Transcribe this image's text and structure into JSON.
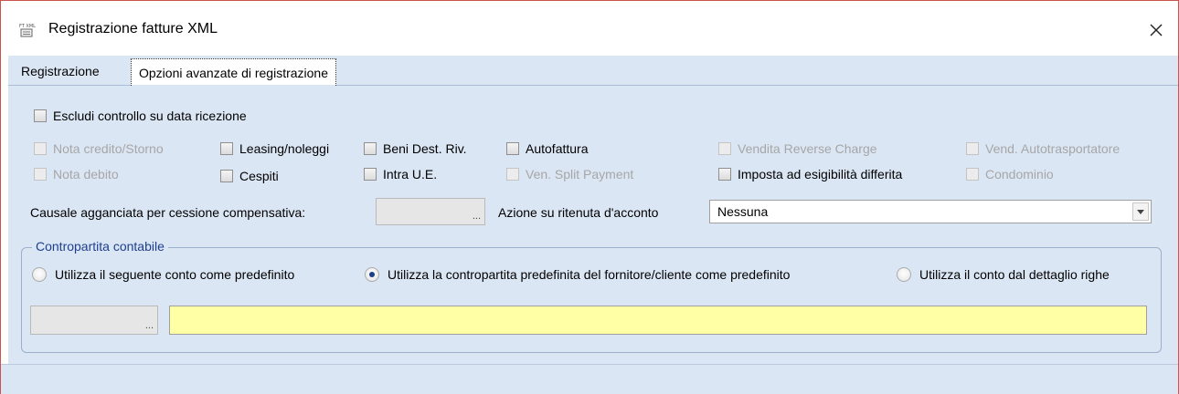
{
  "window": {
    "title": "Registrazione fatture XML",
    "icon_name": "invoice-xml-icon",
    "close_icon": "close-icon",
    "border_color": "#c9544e"
  },
  "tabs": [
    {
      "label": "Registrazione",
      "active": false
    },
    {
      "label": "Opzioni avanzate di registrazione",
      "active": true
    }
  ],
  "options": {
    "escludi_controllo": {
      "label": "Escludi controllo su data ricezione",
      "checked": false,
      "enabled": true
    },
    "row1": [
      {
        "label": "Nota credito/Storno",
        "checked": false,
        "enabled": false
      },
      {
        "label": "Leasing/noleggi",
        "checked": false,
        "enabled": true
      },
      {
        "label": "Beni Dest. Riv.",
        "checked": false,
        "enabled": true
      },
      {
        "label": "Autofattura",
        "checked": false,
        "enabled": true
      },
      {
        "label": "Vendita Reverse Charge",
        "checked": false,
        "enabled": false
      },
      {
        "label": "Vend. Autotrasportatore",
        "checked": false,
        "enabled": false
      }
    ],
    "row2": [
      {
        "label": "Nota debito",
        "checked": false,
        "enabled": false
      },
      {
        "label": "Cespiti",
        "checked": false,
        "enabled": true
      },
      {
        "label": "Intra U.E.",
        "checked": false,
        "enabled": true
      },
      {
        "label": "Ven. Split Payment",
        "checked": false,
        "enabled": false
      },
      {
        "label": "Imposta ad esigibilità differita",
        "checked": false,
        "enabled": true
      },
      {
        "label": "Condominio",
        "checked": false,
        "enabled": false
      }
    ]
  },
  "causale": {
    "label": "Causale agganciata per cessione compensativa:",
    "value": "",
    "button_label": "..."
  },
  "ritenuta": {
    "label": "Azione su ritenuta d'acconto",
    "selected": "Nessuna"
  },
  "contropartita": {
    "title": "Contropartita contabile",
    "title_color": "#1e3f8f",
    "radios": [
      {
        "label": "Utilizza il seguente conto come predefinito",
        "selected": false
      },
      {
        "label": "Utilizza la contropartita predefinita del fornitore/cliente come predefinito",
        "selected": true
      },
      {
        "label": "Utilizza il conto dal dettaglio righe",
        "selected": false
      }
    ],
    "conto_value": "",
    "conto_button_label": "...",
    "descrizione_value": "",
    "descrizione_color": "#ffffa5"
  },
  "colors": {
    "panel_bg": "#dbe6f4",
    "disabled_text": "#a6a6a6"
  }
}
